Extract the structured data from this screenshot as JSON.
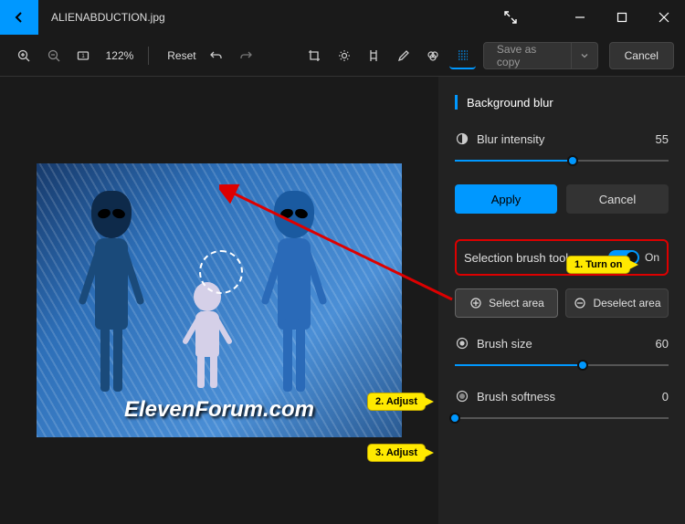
{
  "titlebar": {
    "filename": "ALIENABDUCTION.jpg"
  },
  "toolbar": {
    "zoom_pct": "122%",
    "reset_label": "Reset",
    "save_as_copy_label": "Save as copy",
    "cancel_label": "Cancel"
  },
  "panel": {
    "title": "Background blur",
    "blur_intensity_label": "Blur intensity",
    "blur_intensity_value": "55",
    "apply_label": "Apply",
    "cancel_label": "Cancel",
    "selection_brush_label": "Selection brush tool",
    "toggle_state": "On",
    "select_area_label": "Select area",
    "deselect_area_label": "Deselect area",
    "brush_size_label": "Brush size",
    "brush_size_value": "60",
    "brush_softness_label": "Brush softness",
    "brush_softness_value": "0"
  },
  "callouts": {
    "c1": "1. Turn on",
    "c2": "2. Adjust",
    "c3": "3. Adjust"
  },
  "watermark": "ElevenForum.com"
}
